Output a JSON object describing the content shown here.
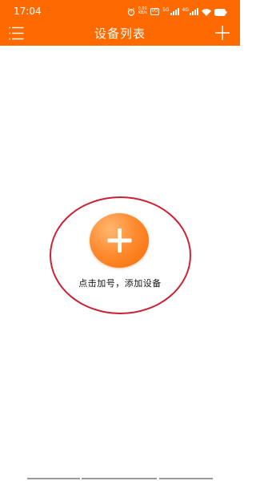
{
  "status_bar": {
    "time": "17:04",
    "speed_value": "0.00",
    "speed_unit": "KB/s",
    "volte_label": "VO",
    "sim1_label": "5G",
    "sim2_label": "4G",
    "icons": [
      "alarm-icon",
      "volte-icon",
      "signal-icon",
      "signal-icon",
      "wifi-icon",
      "battery-icon"
    ]
  },
  "app_bar": {
    "title": "设备列表",
    "menu_icon": "menu-icon",
    "add_icon": "plus-icon"
  },
  "empty_state": {
    "hint": "点击加号，添加设备",
    "add_icon": "plus-icon"
  },
  "colors": {
    "accent": "#ff6a00",
    "annotation": "#cc2233",
    "text": "#111111"
  }
}
